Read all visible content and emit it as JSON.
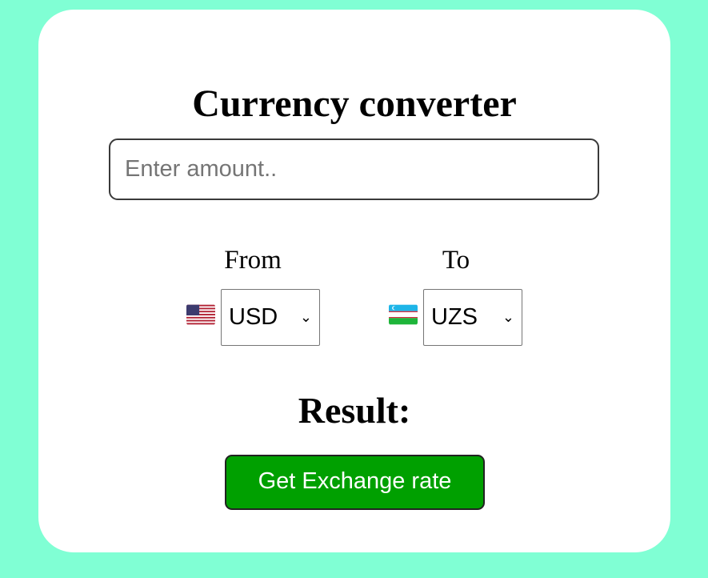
{
  "title": "Currency converter",
  "amount_input": {
    "placeholder": "Enter amount..",
    "value": ""
  },
  "from": {
    "label": "From",
    "flag_icon": "us-flag-icon",
    "selected": "USD"
  },
  "to": {
    "label": "To",
    "flag_icon": "uzbekistan-flag-icon",
    "selected": "UZS"
  },
  "result_label": "Result:",
  "convert_button": {
    "label": "Get Exchange rate",
    "color": "#009900"
  },
  "colors": {
    "page_background": "#80ffd4",
    "card_background": "#ffffff"
  }
}
